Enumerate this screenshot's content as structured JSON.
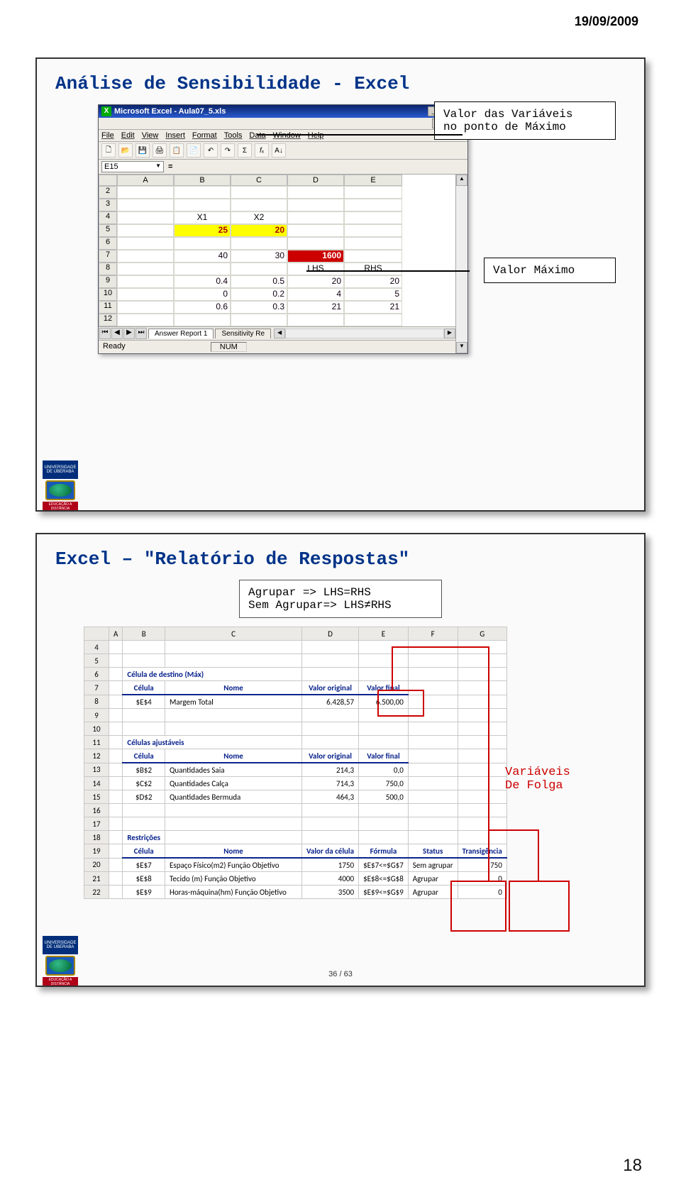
{
  "page_date": "19/09/2009",
  "slide1": {
    "title": "Análise de Sensibilidade - Excel",
    "window_title": "Microsoft Excel - Aula07_5.xls",
    "menus": [
      "File",
      "Edit",
      "View",
      "Insert",
      "Format",
      "Tools",
      "Data",
      "Window",
      "Help"
    ],
    "name_box": "E15",
    "columns": [
      "A",
      "B",
      "C",
      "D",
      "E"
    ],
    "rows": {
      "2": [
        "",
        "",
        "",
        "",
        ""
      ],
      "3": [
        "",
        "",
        "",
        "",
        ""
      ],
      "4": [
        "",
        "X1",
        "X2",
        "",
        ""
      ],
      "5": [
        "",
        "25",
        "20",
        "",
        ""
      ],
      "6": [
        "",
        "",
        "",
        "",
        ""
      ],
      "7": [
        "",
        "40",
        "30",
        "1600",
        ""
      ],
      "8": [
        "",
        "",
        "",
        "LHS",
        "RHS"
      ],
      "9": [
        "",
        "0.4",
        "0.5",
        "20",
        "20"
      ],
      "10": [
        "",
        "0",
        "0.2",
        "4",
        "5"
      ],
      "11": [
        "",
        "0.6",
        "0.3",
        "21",
        "21"
      ],
      "12": [
        "",
        "",
        "",
        "",
        ""
      ]
    },
    "tabs": [
      "Answer Report 1",
      "Sensitivity Re"
    ],
    "status_ready": "Ready",
    "status_caps": "NUM",
    "callout_vars": "Valor das Variáveis\nno ponto de Máximo",
    "callout_max": "Valor Máximo"
  },
  "slide2": {
    "title": "Excel – \"Relatório de Respostas\"",
    "box_line1": "Agrupar => LHS=RHS",
    "box_line2": "Sem Agrupar=> LHS≠RHS",
    "cols": [
      "A",
      "B",
      "C",
      "D",
      "E",
      "F",
      "G"
    ],
    "h_destino": "Célula de destino (Máx)",
    "h_celula": "Célula",
    "h_nome": "Nome",
    "h_val_orig": "Valor original",
    "h_val_final": "Valor final",
    "h_val_celula": "Valor da célula",
    "h_formula": "Fórmula",
    "h_status": "Status",
    "h_transig": "Transigência",
    "h_ajust": "Células ajustáveis",
    "h_restr": "Restrições",
    "r8": {
      "cel": "$E$4",
      "nome": "Margem Total",
      "vo": "6.428,57",
      "vf": "6.500,00"
    },
    "r13": {
      "cel": "$B$2",
      "nome": "Quantidades Saia",
      "vo": "214,3",
      "vf": "0,0"
    },
    "r14": {
      "cel": "$C$2",
      "nome": "Quantidades Calça",
      "vo": "714,3",
      "vf": "750,0"
    },
    "r15": {
      "cel": "$D$2",
      "nome": "Quantidades Bermuda",
      "vo": "464,3",
      "vf": "500,0"
    },
    "r20": {
      "cel": "$E$7",
      "nome": "Espaço Físico(m2) Função Objetivo",
      "vc": "1750",
      "fm": "$E$7<=$G$7",
      "st": "Sem agrupar",
      "tr": "750"
    },
    "r21": {
      "cel": "$E$8",
      "nome": "Tecido (m) Função Objetivo",
      "vc": "4000",
      "fm": "$E$8<=$G$8",
      "st": "Agrupar",
      "tr": "0"
    },
    "r22": {
      "cel": "$E$9",
      "nome": "Horas-máquina(hm) Função Objetivo",
      "vc": "3500",
      "fm": "$E$9<=$G$9",
      "st": "Agrupar",
      "tr": "0"
    },
    "anno_vars": "Variáveis\nDe Folga",
    "footer": "36 / 63"
  },
  "page_number": "18"
}
